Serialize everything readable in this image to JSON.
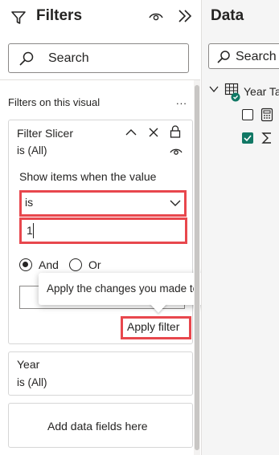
{
  "filters_pane": {
    "title": "Filters",
    "search_placeholder": "Search",
    "section_label": "Filters on this visual",
    "more_label": "...",
    "slicer_card": {
      "title": "Filter Slicer",
      "subtitle": "is (All)",
      "show_items_label": "Show items when the value",
      "operator_value": "is",
      "value_input": "1",
      "logic_and": "And",
      "logic_or": "Or",
      "apply_label": "Apply filter"
    },
    "tooltip_text": "Apply the changes you made to this filter.",
    "year_card": {
      "title": "Year",
      "subtitle": "is (All)"
    },
    "add_fields_label": "Add data fields here"
  },
  "data_pane": {
    "title": "Data",
    "search_placeholder": "Search",
    "table_name": "Year Ta"
  },
  "colors": {
    "highlight_red": "#e8474d",
    "check_green": "#117865",
    "text_dark": "#252423"
  }
}
